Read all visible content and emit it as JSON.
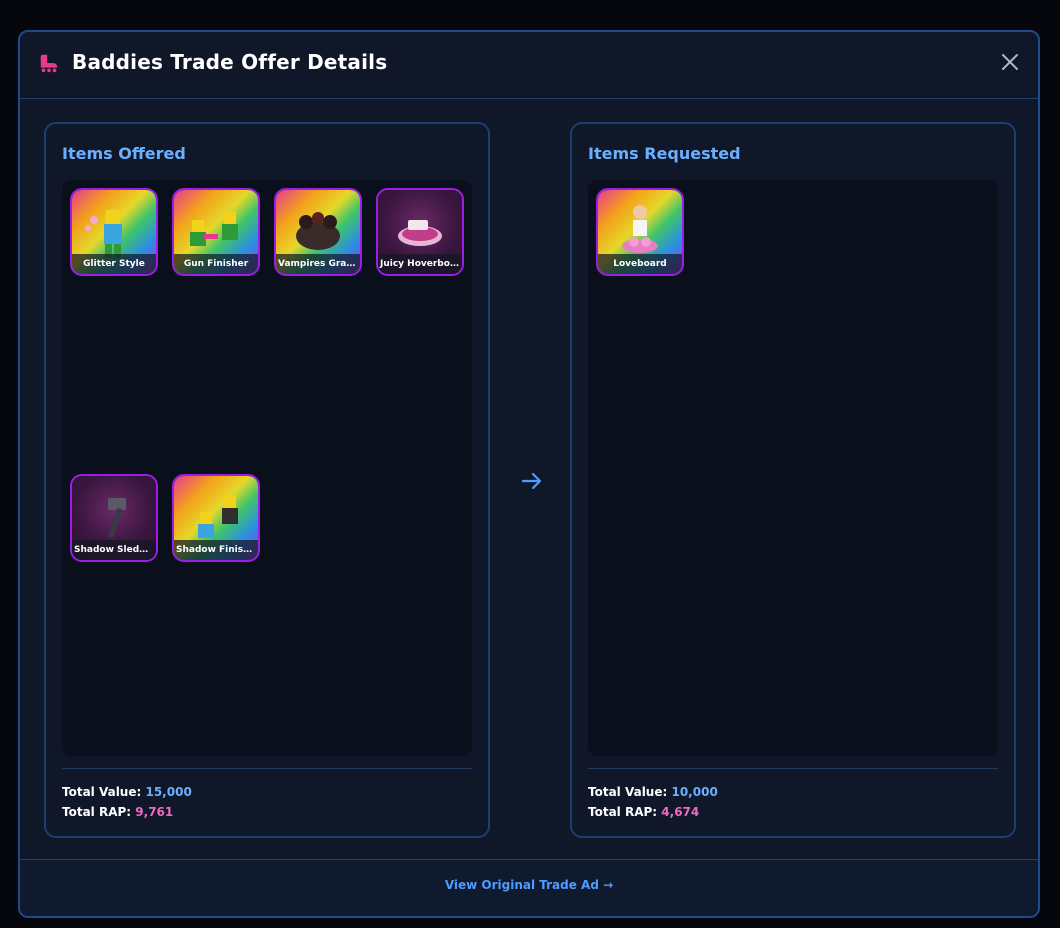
{
  "modal": {
    "title": "Baddies Trade Offer Details",
    "footer_link": "View Original Trade Ad →"
  },
  "offered": {
    "heading": "Items Offered",
    "items": [
      {
        "name": "Glitter Style",
        "style": "rainbow",
        "icon": "glitter-character-icon"
      },
      {
        "name": "Gun Finisher",
        "style": "rainbow",
        "icon": "gun-finisher-icon"
      },
      {
        "name": "Vampires Grasp ...",
        "style": "rainbow",
        "icon": "vampire-icon"
      },
      {
        "name": "Juicy Hoverboard",
        "style": "purple",
        "icon": "hoverboard-icon"
      },
      {
        "name": "Shadow Sledgeh...",
        "style": "purple",
        "icon": "sledgehammer-icon"
      },
      {
        "name": "Shadow Finisher",
        "style": "rainbow",
        "icon": "shadow-finisher-icon"
      }
    ],
    "total_value_label": "Total Value:",
    "total_value": "15,000",
    "total_rap_label": "Total RAP:",
    "total_rap": "9,761"
  },
  "requested": {
    "heading": "Items Requested",
    "items": [
      {
        "name": "Loveboard",
        "style": "rainbow",
        "icon": "loveboard-icon"
      }
    ],
    "total_value_label": "Total Value:",
    "total_value": "10,000",
    "total_rap_label": "Total RAP:",
    "total_rap": "4,674"
  },
  "colors": {
    "accent_blue": "#6bb0ff",
    "rap_pink": "#ee6bc2",
    "item_border": "#9b1ee6"
  }
}
